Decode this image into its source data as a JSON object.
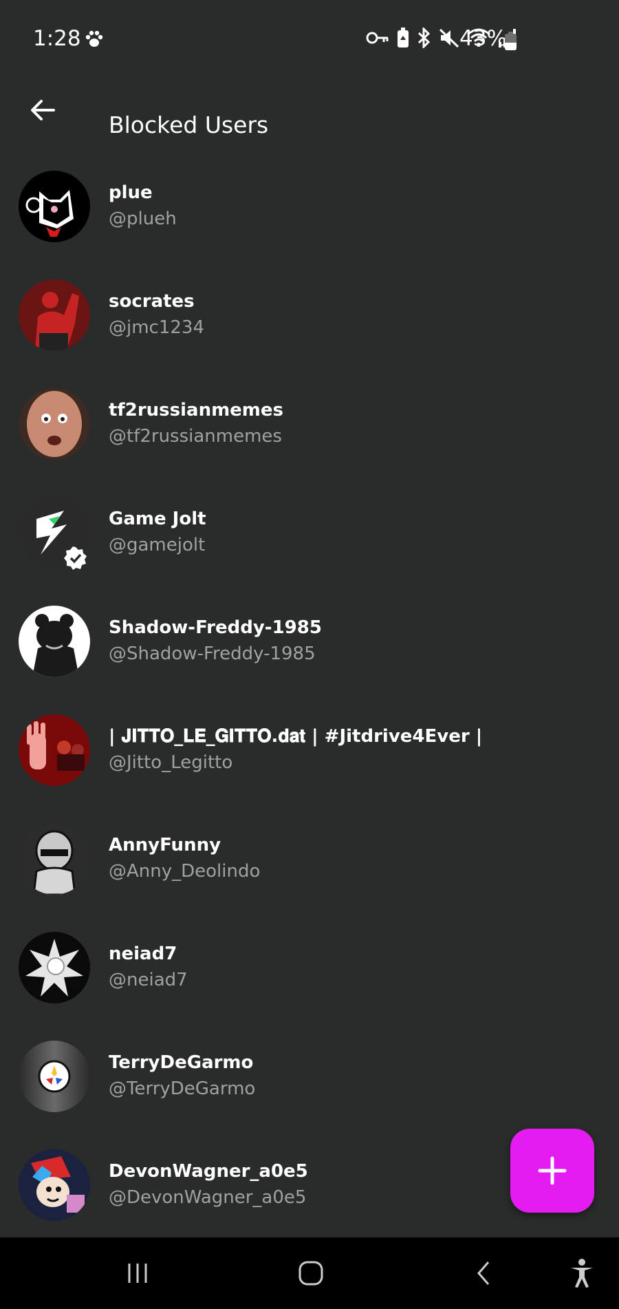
{
  "status_bar": {
    "time": "1:28",
    "battery_percent": "43%",
    "battery_level": 0.43,
    "icons": [
      "paw-icon",
      "key-icon",
      "battery-saver-icon",
      "bluetooth-icon",
      "mute-icon",
      "wifi-icon",
      "signal-icon"
    ]
  },
  "app_bar": {
    "title": "Blocked Users",
    "back_icon": "arrow-left-icon"
  },
  "users": [
    {
      "name": "plue",
      "handle": "@plueh",
      "color": "#000000",
      "verified": false
    },
    {
      "name": "socrates",
      "handle": "@jmc1234",
      "color": "#7a1616",
      "verified": false
    },
    {
      "name": "tf2russianmemes",
      "handle": "@tf2russianmemes",
      "color": "#b0776a",
      "verified": false
    },
    {
      "name": "Game Jolt",
      "handle": "@gamejolt",
      "color": "#2a2a2a",
      "verified": true
    },
    {
      "name": "Shadow-Freddy-1985",
      "handle": "@Shadow-Freddy-1985",
      "color": "#ffffff",
      "verified": false
    },
    {
      "name": "| 𝐉𝐈𝐓𝐓𝐎_𝐋𝐄_𝐆𝐈𝐓𝐓𝐎.𝐝𝐚𝐭 | #Jitdrive4Ever |",
      "handle": "@Jitto_Legitto",
      "color": "#8a0c0c",
      "verified": false
    },
    {
      "name": "AnnyFunny",
      "handle": "@Anny_Deolindo",
      "color": "#2c2c2c",
      "verified": false
    },
    {
      "name": "neiad7",
      "handle": "@neiad7",
      "color": "#0a0a0a",
      "verified": false
    },
    {
      "name": "TerryDeGarmo",
      "handle": "@TerryDeGarmo",
      "color": "#4a4a4a",
      "verified": false
    },
    {
      "name": "DevonWagner_a0e5",
      "handle": "@DevonWagner_a0e5",
      "color": "#2a6fd1",
      "verified": false
    }
  ],
  "fab": {
    "icon": "plus-icon",
    "color": "#e41cf2"
  },
  "nav_bar": {
    "icons": [
      "recent-apps-icon",
      "home-icon",
      "back-icon",
      "accessibility-icon"
    ]
  }
}
